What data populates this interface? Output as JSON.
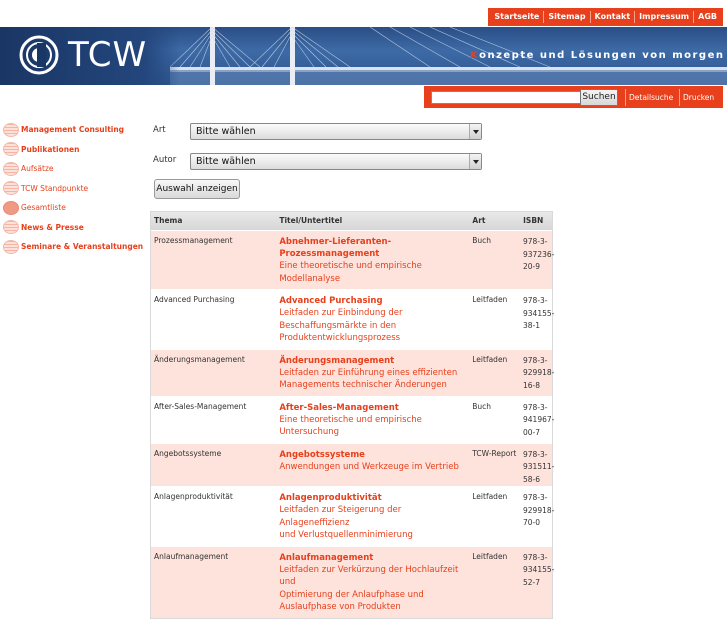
{
  "topnav": [
    "Startseite",
    "Sitemap",
    "Kontakt",
    "Impressum",
    "AGB"
  ],
  "header": {
    "logo_text": "TCW",
    "tagline_first": "K",
    "tagline_rest": "onzepte und Lösungen von morgen"
  },
  "search": {
    "value": "",
    "button": "Suchen",
    "links": [
      "Detailsuche",
      "Drucken"
    ]
  },
  "sidebar": {
    "items": [
      {
        "label": "Management Consulting",
        "bold": true
      },
      {
        "label": "Publikationen",
        "bold": true
      },
      {
        "label": "Aufsätze",
        "bold": false
      },
      {
        "label": "TCW Standpunkte",
        "bold": false
      },
      {
        "label": "Gesamtliste",
        "bold": false
      },
      {
        "label": "News & Presse",
        "bold": true
      },
      {
        "label": "Seminare & Veranstaltungen",
        "bold": true
      }
    ]
  },
  "filters": {
    "art_label": "Art",
    "art_value": "Bitte wählen",
    "autor_label": "Autor",
    "autor_value": "Bitte wählen",
    "show_button": "Auswahl anzeigen"
  },
  "table": {
    "headers": [
      "Thema",
      "Titel/Untertitel",
      "Art",
      "ISBN"
    ],
    "rows": [
      {
        "thema": "Prozessmanagement",
        "title": "Abnehmer-Lieferanten-Prozessmanagement",
        "subtitle": [
          "Eine theoretische und empirische",
          "Modellanalyse"
        ],
        "art": "Buch",
        "isbn": [
          "978-3-",
          "937236-",
          "20-9"
        ]
      },
      {
        "thema": "Advanced Purchasing",
        "title": "Advanced Purchasing",
        "subtitle": [
          "Leitfaden zur Einbindung der",
          "Beschaffungsmärkte in den",
          "Produktentwicklungsprozess"
        ],
        "art": "Leitfaden",
        "isbn": [
          "978-3-",
          "934155-",
          "38-1"
        ]
      },
      {
        "thema": "Änderungsmanagement",
        "title": "Änderungsmanagement",
        "subtitle": [
          "Leitfaden zur Einführung eines effizienten",
          "Managements technischer Änderungen"
        ],
        "art": "Leitfaden",
        "isbn": [
          "978-3-",
          "929918-",
          "16-8"
        ]
      },
      {
        "thema": "After-Sales-Management",
        "title": "After-Sales-Management",
        "subtitle": [
          "Eine theoretische und empirische",
          "Untersuchung"
        ],
        "art": "Buch",
        "isbn": [
          "978-3-",
          "941967-",
          "00-7"
        ]
      },
      {
        "thema": "Angebotssysteme",
        "title": "Angebotssysteme",
        "subtitle": [
          "Anwendungen und Werkzeuge im Vertrieb"
        ],
        "art": "TCW-Report",
        "isbn": [
          "978-3-",
          "931511-",
          "58-6"
        ]
      },
      {
        "thema": "Anlagenproduktivität",
        "title": "Anlagenproduktivität",
        "subtitle": [
          "Leitfaden zur Steigerung der Anlageneffizienz",
          "und Verlustquellenminimierung"
        ],
        "art": "Leitfaden",
        "isbn": [
          "978-3-",
          "929918-",
          "70-0"
        ]
      },
      {
        "thema": "Anlaufmanagement",
        "title": "Anlaufmanagement",
        "subtitle": [
          "Leitfaden zur Verkürzung der Hochlaufzeit und",
          "Optimierung der Anlaufphase und",
          "Auslaufphase von Produkten"
        ],
        "art": "Leitfaden",
        "isbn": [
          "978-3-",
          "934155-",
          "52-7"
        ]
      }
    ]
  },
  "colors": {
    "accent": "#e8401c",
    "row_tint": "#fde3dc",
    "banner": "#2e5590"
  }
}
